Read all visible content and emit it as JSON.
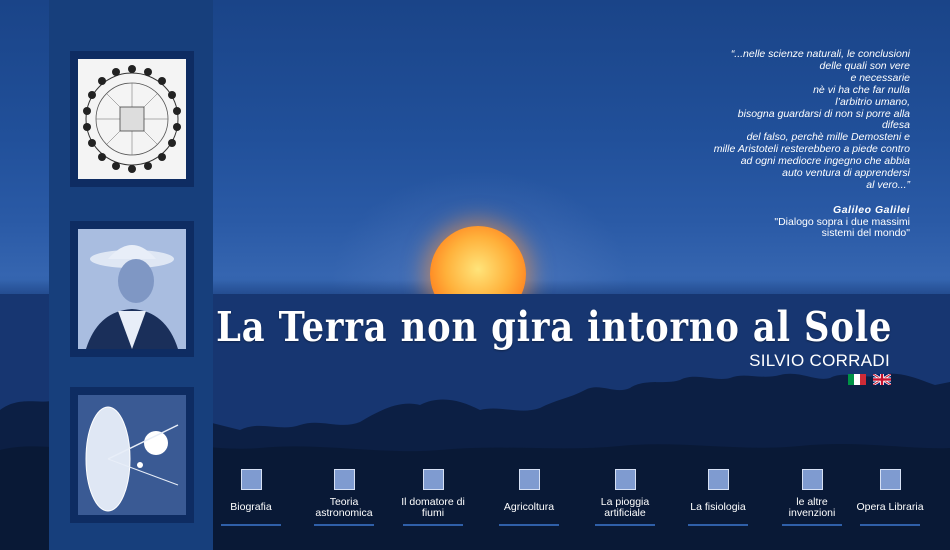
{
  "quote": {
    "lines": [
      "“...nelle scienze naturali, le conclusioni",
      "delle quali son vere",
      "e necessarie",
      "nè vi ha che far nulla",
      "l’arbitrio umano,",
      "bisogna guardarsi di non si porre alla",
      "difesa",
      "del falso, perchè mille Demosteni e",
      "mille Aristoteli resterebbero a piede contro",
      "ad ogni mediocre ingegno che abbia",
      "auto ventura di apprendersi",
      "al vero...”"
    ],
    "author": "Galileo Galilei",
    "source_line1": "\"Dialogo sopra i due massimi",
    "source_line2": "sistemi del mondo\""
  },
  "title": "La Terra non gira intorno al Sole",
  "subtitle": "SILVIO CORRADI",
  "flags": [
    {
      "name": "flag-italian-icon",
      "lang": "it"
    },
    {
      "name": "flag-english-icon",
      "lang": "en"
    }
  ],
  "nav": [
    {
      "label": "Biografia",
      "icon": "portrait-thumb-icon"
    },
    {
      "label": "Teoria astronomica",
      "icon": "planet-thumb-icon"
    },
    {
      "label": "Il domatore di fiumi",
      "icon": "river-thumb-icon"
    },
    {
      "label": "Agricoltura",
      "icon": "field-thumb-icon"
    },
    {
      "label": "La pioggia artificiale",
      "icon": "rain-thumb-icon"
    },
    {
      "label": "La fisiologia",
      "icon": "body-thumb-icon"
    },
    {
      "label": "le altre invenzioni",
      "icon": "invention-thumb-icon"
    },
    {
      "label": "Opera Libraria",
      "icon": "book-thumb-icon"
    }
  ],
  "colors": {
    "sky": "#2a5aa6",
    "sidebar": "#173f7c",
    "frame": "#0e2c62",
    "sun": "#ffb13b",
    "text": "#ffffff"
  }
}
